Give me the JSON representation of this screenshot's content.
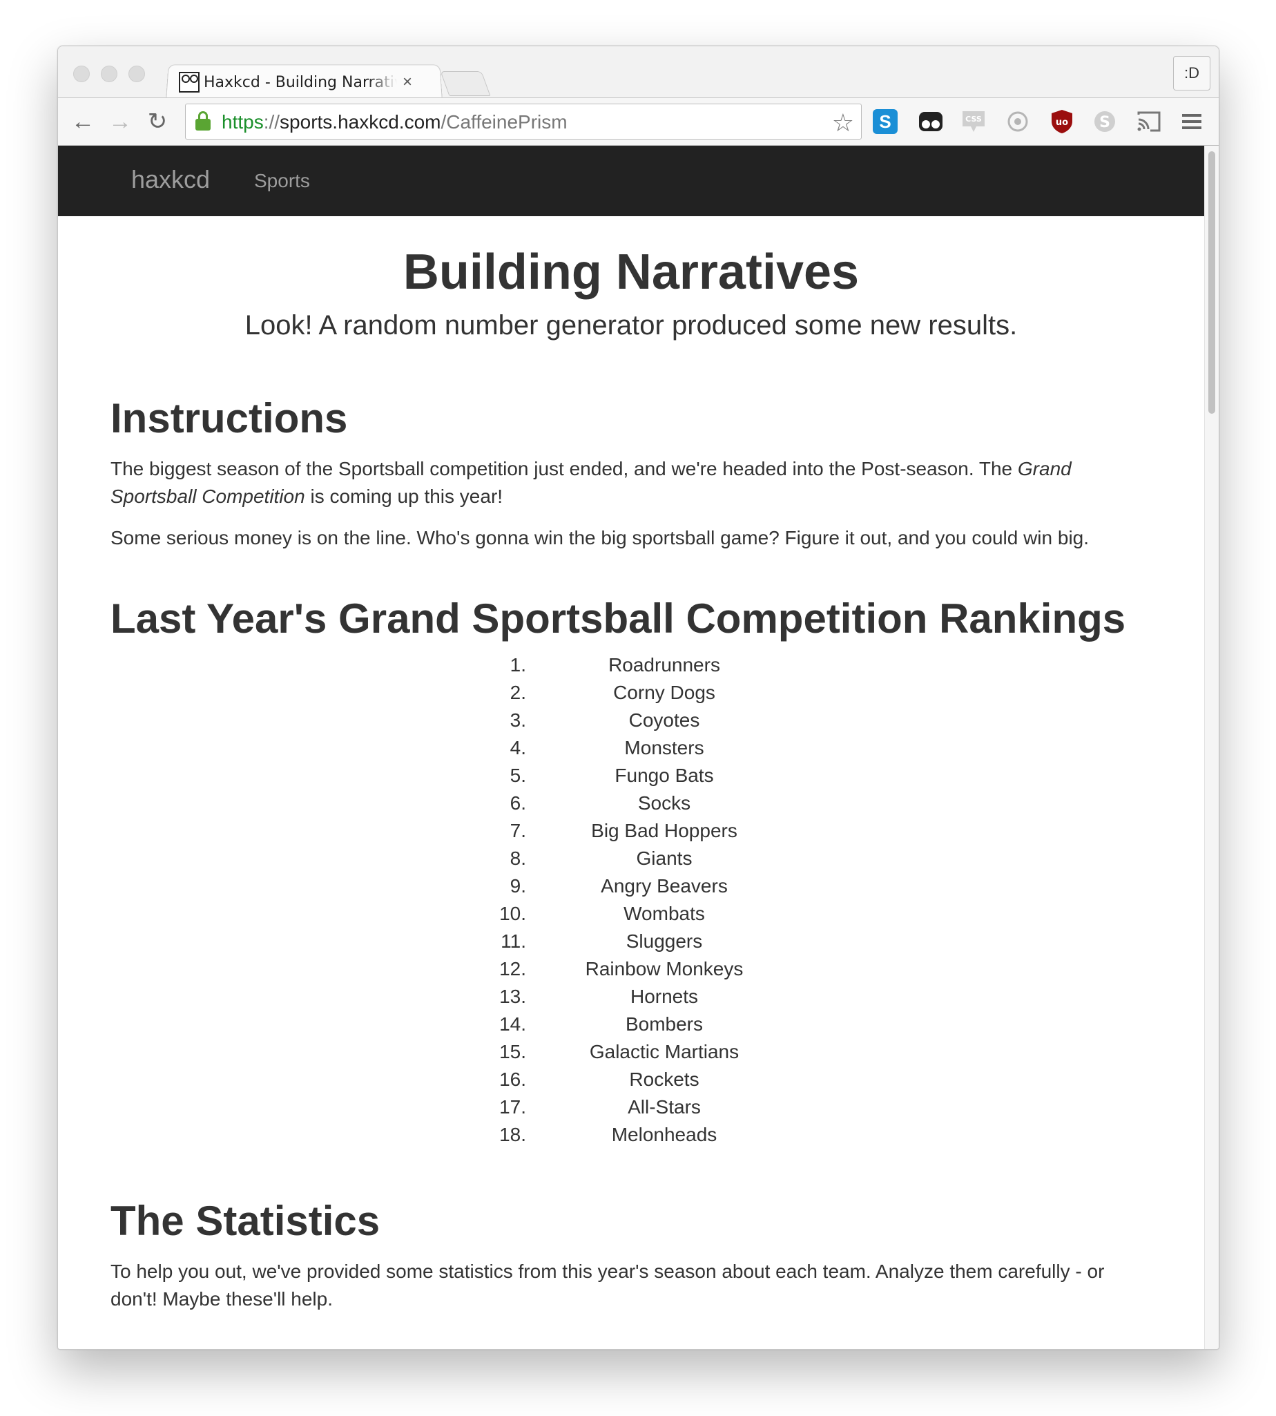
{
  "browser": {
    "tab_title": "Haxkcd - Building Narratives",
    "tab_close": "×",
    "profile_label": ":D",
    "url_scheme": "https",
    "url_sep": "://",
    "url_host": "sports.haxkcd.com",
    "url_path": "/CaffeinePrism",
    "accent_green": "#1a8f2a",
    "icons": [
      "back-icon",
      "forward-icon",
      "reload-icon",
      "lock-icon",
      "star-icon",
      "skype-s-icon",
      "ghostery-icon",
      "css-icon",
      "circle-ext-icon",
      "ublock-icon",
      "skype-icon",
      "cast-icon",
      "menu-icon"
    ]
  },
  "navbar": {
    "brand": "haxkcd",
    "link": "Sports",
    "background": "#222222"
  },
  "jumbotron": {
    "title": "Building Narratives",
    "lead": "Look! A random number generator produced some new results."
  },
  "instructions": {
    "heading": "Instructions",
    "p1_before": "The biggest season of the Sportsball competition just ended, and we're headed into the Post-season. The ",
    "p1_em": "Grand Sportsball Competition",
    "p1_after": " is coming up this year!",
    "p2": "Some serious money is on the line. Who's gonna win the big sportsball game? Figure it out, and you could win big."
  },
  "rankings": {
    "heading": "Last Year's Grand Sportsball Competition Rankings",
    "items": [
      {
        "rank": "1.",
        "team": "Roadrunners"
      },
      {
        "rank": "2.",
        "team": "Corny Dogs"
      },
      {
        "rank": "3.",
        "team": "Coyotes"
      },
      {
        "rank": "4.",
        "team": "Monsters"
      },
      {
        "rank": "5.",
        "team": "Fungo Bats"
      },
      {
        "rank": "6.",
        "team": "Socks"
      },
      {
        "rank": "7.",
        "team": "Big Bad Hoppers"
      },
      {
        "rank": "8.",
        "team": "Giants"
      },
      {
        "rank": "9.",
        "team": "Angry Beavers"
      },
      {
        "rank": "10.",
        "team": "Wombats"
      },
      {
        "rank": "11.",
        "team": "Sluggers"
      },
      {
        "rank": "12.",
        "team": "Rainbow Monkeys"
      },
      {
        "rank": "13.",
        "team": "Hornets"
      },
      {
        "rank": "14.",
        "team": "Bombers"
      },
      {
        "rank": "15.",
        "team": "Galactic Martians"
      },
      {
        "rank": "16.",
        "team": "Rockets"
      },
      {
        "rank": "17.",
        "team": "All-Stars"
      },
      {
        "rank": "18.",
        "team": "Melonheads"
      }
    ]
  },
  "statistics": {
    "heading": "The Statistics",
    "p1": "To help you out, we've provided some statistics from this year's season about each team. Analyze them carefully - or don't! Maybe these'll help."
  }
}
